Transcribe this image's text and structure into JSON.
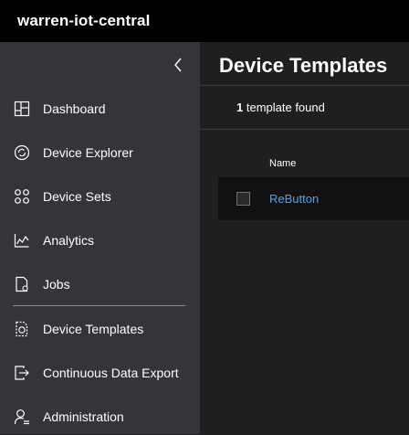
{
  "app": {
    "title": "warren-iot-central"
  },
  "sidebar": {
    "collapse_icon": "chevron-left-icon",
    "items": [
      {
        "label": "Dashboard",
        "icon": "dashboard-icon"
      },
      {
        "label": "Device Explorer",
        "icon": "device-explorer-icon"
      },
      {
        "label": "Device Sets",
        "icon": "device-sets-icon"
      },
      {
        "label": "Analytics",
        "icon": "analytics-icon"
      },
      {
        "label": "Jobs",
        "icon": "jobs-icon"
      },
      {
        "label": "Device Templates",
        "icon": "device-templates-icon"
      },
      {
        "label": "Continuous Data Export",
        "icon": "data-export-icon"
      },
      {
        "label": "Administration",
        "icon": "administration-icon"
      }
    ]
  },
  "main": {
    "title": "Device Templates",
    "count": {
      "number": "1",
      "suffix": " template found"
    },
    "table": {
      "columns": [
        "Name"
      ],
      "rows": [
        {
          "name": "ReButton"
        }
      ]
    }
  },
  "colors": {
    "topbar": "#000000",
    "sidebar": "#333539",
    "main": "#1f1f1f",
    "row": "#111111",
    "link": "#4ea1f5"
  }
}
